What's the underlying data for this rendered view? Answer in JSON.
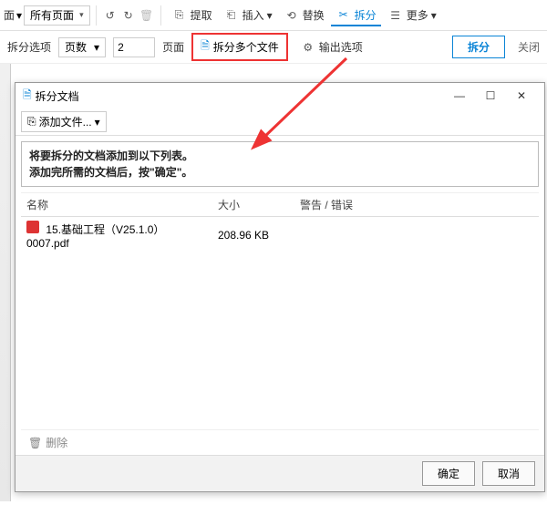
{
  "toolbar1": {
    "pages_left_label": "面",
    "all_pages_label": "所有页面",
    "extract_label": "提取",
    "insert_label": "插入",
    "replace_label": "替换",
    "split_label": "拆分",
    "more_label": "更多"
  },
  "toolbar2": {
    "split_options_label": "拆分选项",
    "mode_label": "页数",
    "count_value": "2",
    "page_unit_label": "页面",
    "split_multi_label": "拆分多个文件",
    "output_options_label": "输出选项",
    "primary_split_label": "拆分",
    "close_label": "关闭"
  },
  "dialog": {
    "title": "拆分文档",
    "add_files_label": "添加文件...",
    "hint_line1": "将要拆分的文档添加到以下列表。",
    "hint_line2": "添加完所需的文档后，按\"确定\"。",
    "col_name": "名称",
    "col_size": "大小",
    "col_err": "警告 / 错误",
    "rows": [
      {
        "name": "15.基础工程（V25.1.0）0007.pdf",
        "size": "208.96 KB",
        "err": ""
      }
    ],
    "delete_label": "删除",
    "ok_label": "确定",
    "cancel_label": "取消"
  }
}
